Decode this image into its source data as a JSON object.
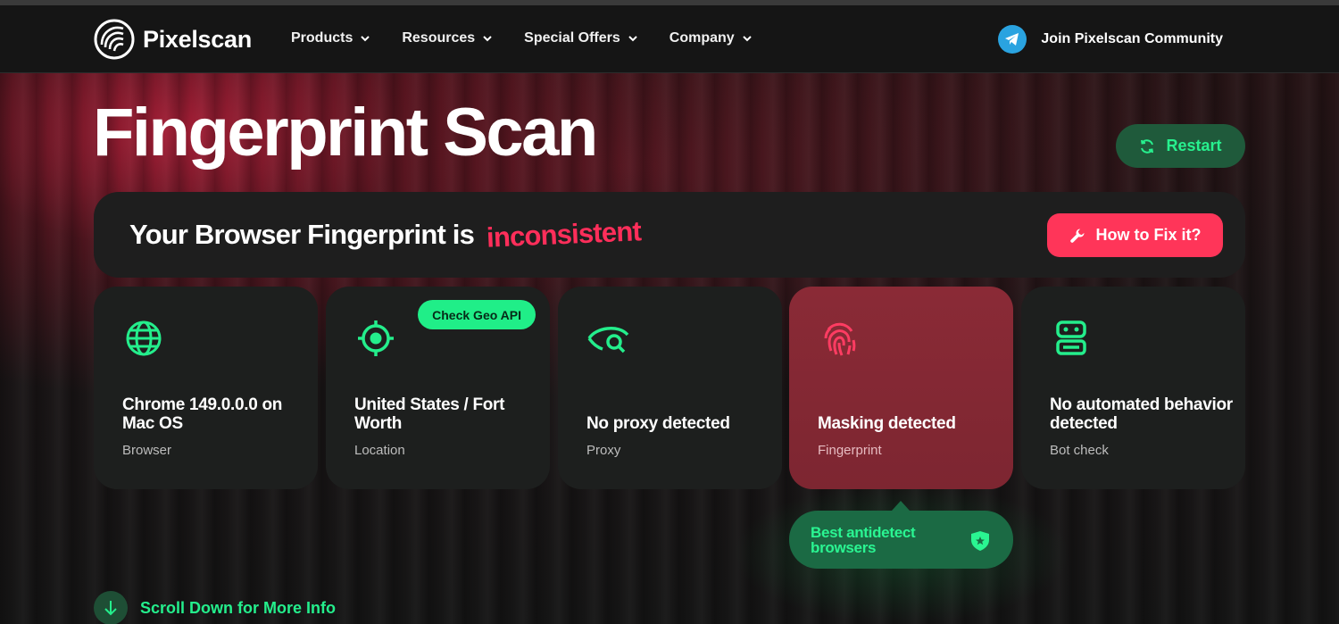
{
  "header": {
    "brand": "Pixelscan",
    "nav": [
      {
        "label": "Products"
      },
      {
        "label": "Resources"
      },
      {
        "label": "Special Offers"
      },
      {
        "label": "Company"
      }
    ],
    "community_label": "Join Pixelscan Community"
  },
  "page": {
    "title": "Fingerprint Scan",
    "restart_label": "Restart"
  },
  "banner": {
    "prefix": "Your Browser Fingerprint is",
    "status": "inconsistent",
    "fix_label": "How to Fix it?"
  },
  "cards": [
    {
      "value": "Chrome 149.0.0.0 on Mac OS",
      "label": "Browser",
      "icon": "globe-icon"
    },
    {
      "value": "United States / Fort Worth",
      "label": "Location",
      "icon": "target-icon",
      "badge": "Check Geo API"
    },
    {
      "value": "No proxy detected",
      "label": "Proxy",
      "icon": "eye-search-icon"
    },
    {
      "value": "Masking detected",
      "label": "Fingerprint",
      "icon": "fingerprint-icon"
    },
    {
      "value": "No automated behavior detected",
      "label": "Bot check",
      "icon": "robot-icon"
    }
  ],
  "promo": {
    "label": "Best antidetect browsers"
  },
  "scroll_label": "Scroll Down for More Info",
  "colors": {
    "accent_green": "#27f08e",
    "alert_red": "#ff3559",
    "card_bg": "#1d1f1e",
    "card_alert_bg": "#8a2a36"
  }
}
